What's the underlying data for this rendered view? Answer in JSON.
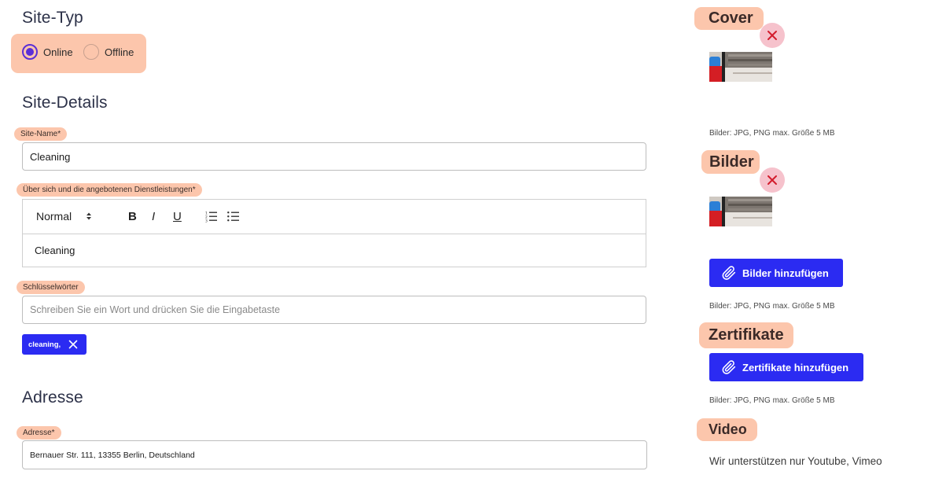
{
  "site_type": {
    "title": "Site-Typ",
    "options": [
      {
        "label": "Online",
        "checked": true
      },
      {
        "label": "Offline",
        "checked": false
      }
    ]
  },
  "details": {
    "title": "Site-Details",
    "name_label": "Site-Name*",
    "name_value": "Cleaning",
    "about_label": "Über sich und die angebotenen Dienstleistungen*",
    "editor": {
      "format": "Normal",
      "bold": "B",
      "italic": "I",
      "underline": "U",
      "content": "Cleaning"
    },
    "keywords_label": "Schlüsselwörter",
    "keywords_placeholder": "Schreiben Sie ein Wort und drücken Sie die Eingabetaste",
    "keyword_chip": "cleaning,"
  },
  "address": {
    "title": "Adresse",
    "label": "Adresse*",
    "value": "Bernauer Str. 111, 13355 Berlin, Deutschland"
  },
  "media": {
    "cover_title": "Cover",
    "cover_hint": "Bilder: JPG, PNG max. Größe 5 MB",
    "images_title": "Bilder",
    "add_images_button": "Bilder hinzufügen",
    "images_hint": "Bilder: JPG, PNG max. Größe 5 MB",
    "certificates_title": "Zertifikate",
    "add_certificates_button": "Zertifikate hinzufügen",
    "certificates_hint": "Bilder: JPG, PNG max. Größe 5 MB",
    "video_title": "Video",
    "video_note": "Wir unterstützen nur Youtube, Vimeo"
  },
  "colors": {
    "highlight": "#fcc6ac",
    "accent": "#2b2bf2",
    "radio": "#5b2fd6",
    "remove_bg": "#f6c2cc",
    "remove_x": "#d31c2c"
  }
}
